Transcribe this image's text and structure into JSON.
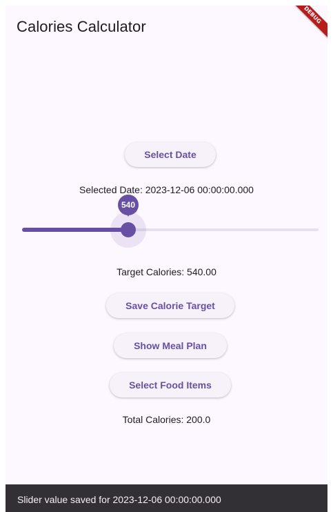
{
  "app_bar": {
    "title": "Calories Calculator",
    "debug_label": "DEBUG"
  },
  "date_picker": {
    "button_label": "Select Date",
    "selected_text": "Selected Date: 2023-12-06 00:00:00.000"
  },
  "calorie_slider": {
    "value_label": "540",
    "value_fraction": 0.358,
    "accent_color": "#6750a4"
  },
  "target": {
    "text": "Target Calories: 540.00"
  },
  "actions": {
    "save_label": "Save Calorie Target",
    "meal_plan_label": "Show Meal Plan",
    "food_items_label": "Select Food Items"
  },
  "totals": {
    "text": "Total Calories: 200.0"
  },
  "snackbar": {
    "message": "Slider value saved for 2023-12-06 00:00:00.000"
  }
}
